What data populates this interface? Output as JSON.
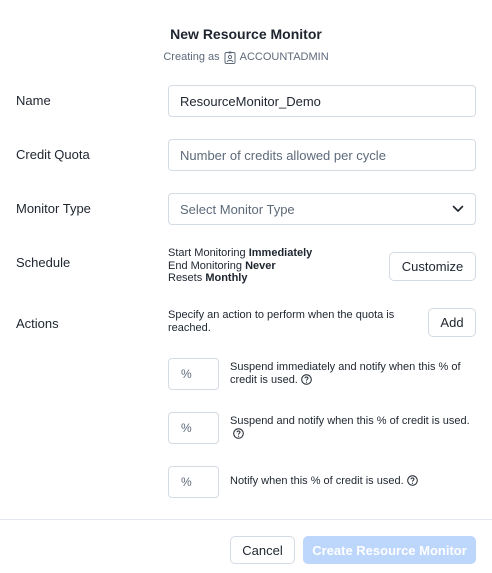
{
  "header": {
    "title": "New Resource Monitor",
    "creating_as_label": "Creating as",
    "role": "ACCOUNTADMIN",
    "role_icon": "user-badge-icon"
  },
  "form": {
    "name": {
      "label": "Name",
      "value": "ResourceMonitor_Demo"
    },
    "credit_quota": {
      "label": "Credit Quota",
      "placeholder": "Number of credits allowed per cycle"
    },
    "monitor_type": {
      "label": "Monitor Type",
      "selected": "Select Monitor Type"
    },
    "schedule": {
      "label": "Schedule",
      "start_prefix": "Start Monitoring",
      "start_value": "Immediately",
      "end_prefix": "End Monitoring",
      "end_value": "Never",
      "resets_prefix": "Resets",
      "resets_value": "Monthly",
      "customize_label": "Customize"
    },
    "actions": {
      "label": "Actions",
      "description": "Specify an action to perform when the quota is reached.",
      "add_label": "Add",
      "items": [
        {
          "value": "%",
          "text": "Suspend immediately and notify when this % of credit is used."
        },
        {
          "value": "%",
          "text": "Suspend and notify when this % of credit is used."
        },
        {
          "value": "%",
          "text": "Notify when this % of credit is used."
        }
      ]
    }
  },
  "footer": {
    "cancel_label": "Cancel",
    "create_label": "Create Resource Monitor"
  },
  "colors": {
    "primary_disabled": "#bdd6fb",
    "border": "#d5dbe3",
    "text": "#1e252f",
    "muted": "#5d6a7a"
  }
}
